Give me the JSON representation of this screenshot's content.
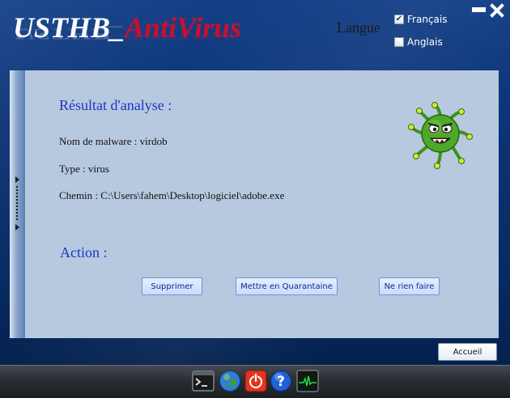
{
  "app": {
    "title_part1": "USTHB_",
    "title_part2": "AntiVirus"
  },
  "language": {
    "label": "Langue",
    "options": [
      {
        "label": "Français",
        "checked": true
      },
      {
        "label": "Anglais",
        "checked": false
      }
    ]
  },
  "window_controls": {
    "minimize": "minimize-icon",
    "close": "close-icon"
  },
  "result": {
    "heading": "Résultat d'analyse :",
    "malware_name": "Nom de malware : virdob",
    "type": "Type : virus",
    "path": "Chemin : C:\\Users\\fahem\\Desktop\\logiciel\\adobe.exe"
  },
  "action": {
    "heading": "Action :",
    "buttons": {
      "delete": "Supprimer",
      "quarantine": "Mettre en Quarantaine",
      "ignore": "Ne rien faire"
    }
  },
  "footer": {
    "home_button": "Accueil"
  },
  "taskbar": {
    "icons": [
      "terminal-icon",
      "globe-icon",
      "power-icon",
      "help-icon",
      "monitor-icon"
    ]
  },
  "colors": {
    "background": "#0d3477",
    "panel": "#b6c9df",
    "heading_blue": "#1f33c9",
    "title_red": "#c8102e"
  }
}
